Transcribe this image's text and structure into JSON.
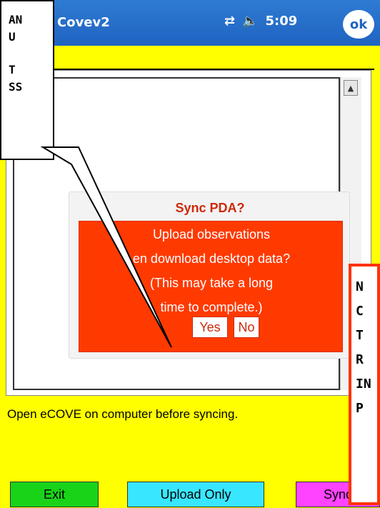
{
  "title_bar": {
    "app_title": "Covev2",
    "time": "5:09",
    "ok_label": "ok"
  },
  "dialog": {
    "title": "Sync PDA?",
    "lines": [
      "Upload observations",
      "en download desktop data?",
      "(This may take a long",
      "time to complete.)"
    ],
    "yes_label": "Yes",
    "no_label": "No"
  },
  "status_text": "Open eCOVE on computer before syncing.",
  "buttons": {
    "exit": "Exit",
    "upload_only": "Upload Only",
    "sync": "Sync"
  },
  "callouts": {
    "top_left": [
      "AN",
      "U",
      "",
      "T",
      "SS"
    ],
    "right": [
      "N",
      "C",
      "T",
      "R",
      "IN",
      "P"
    ]
  },
  "icons": {
    "network": "network-icon",
    "volume": "volume-icon",
    "ok": "ok-icon"
  },
  "colors": {
    "title_blue": "#1f63c1",
    "background_yellow": "#ffff00",
    "dialog_red": "#ff3a00",
    "exit_green": "#19d319",
    "upload_cyan": "#39e6ff",
    "sync_magenta": "#ff43ff",
    "callout_border_orange": "#ff3300"
  }
}
